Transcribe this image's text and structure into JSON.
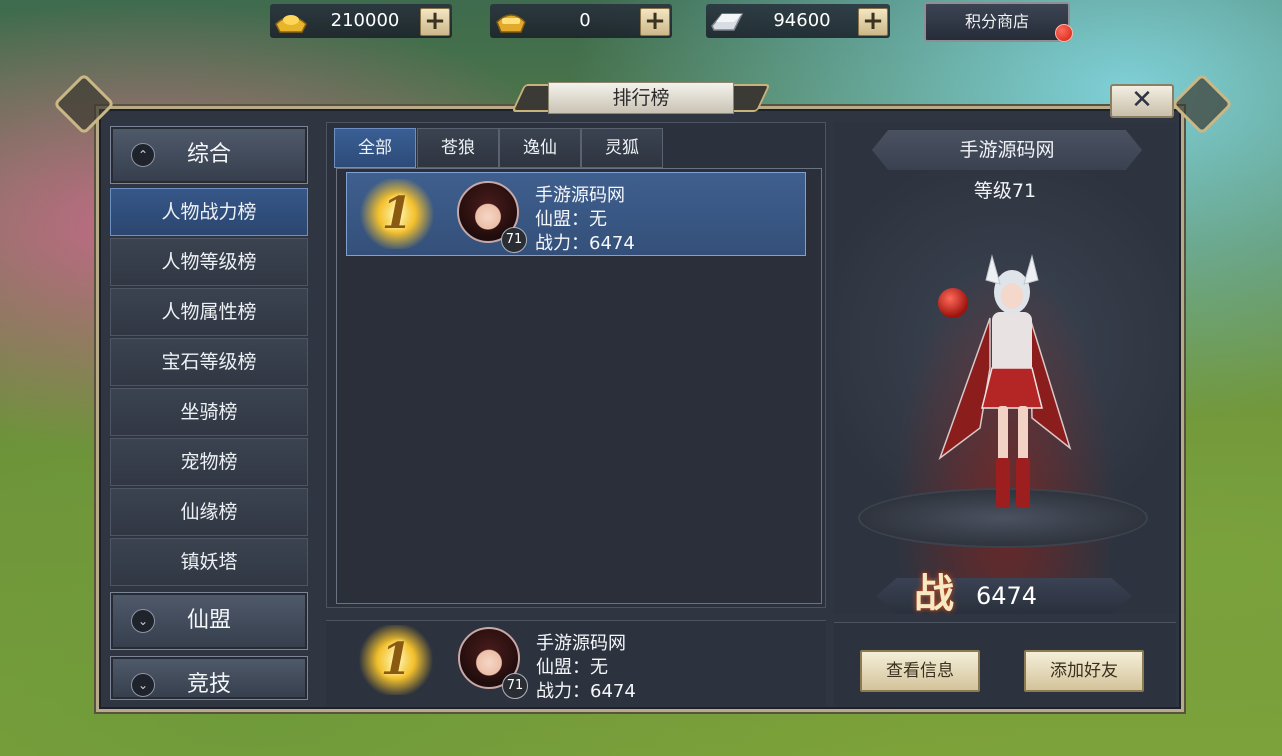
{
  "resources": [
    {
      "icon": "gold-ingot-icon",
      "value": "210000"
    },
    {
      "icon": "bound-gold-icon",
      "value": "0"
    },
    {
      "icon": "silver-ingot-icon",
      "value": "94600"
    }
  ],
  "plus_label": "+",
  "shop_label": "积分商店",
  "window": {
    "title": "排行榜",
    "close_label": "✕"
  },
  "menu": {
    "categories": [
      {
        "label": "综合",
        "chev": "⌃"
      },
      {
        "label": "仙盟",
        "chev": "⌄"
      },
      {
        "label": "竞技",
        "chev": "⌄"
      }
    ],
    "items": [
      "人物战力榜",
      "人物等级榜",
      "人物属性榜",
      "宝石等级榜",
      "坐骑榜",
      "宠物榜",
      "仙缘榜",
      "镇妖塔"
    ]
  },
  "tabs": [
    "全部",
    "苍狼",
    "逸仙",
    "灵狐"
  ],
  "ranking": [
    {
      "rank": "1",
      "name": "手游源码网",
      "guild": "仙盟：无",
      "power": "战力：6474",
      "level": "71"
    }
  ],
  "self_entry": {
    "rank": "1",
    "name": "手游源码网",
    "guild": "仙盟：无",
    "power": "战力：6474",
    "level": "71"
  },
  "character": {
    "name": "手游源码网",
    "level_text": "等级71",
    "power_char": "战",
    "power_value": "6474"
  },
  "actions": {
    "view_info": "查看信息",
    "add_friend": "添加好友"
  },
  "colors": {
    "active_tab": "#3a5f95",
    "frame_gold": "#b8ab8a",
    "button_cream": "#f5efd9"
  }
}
